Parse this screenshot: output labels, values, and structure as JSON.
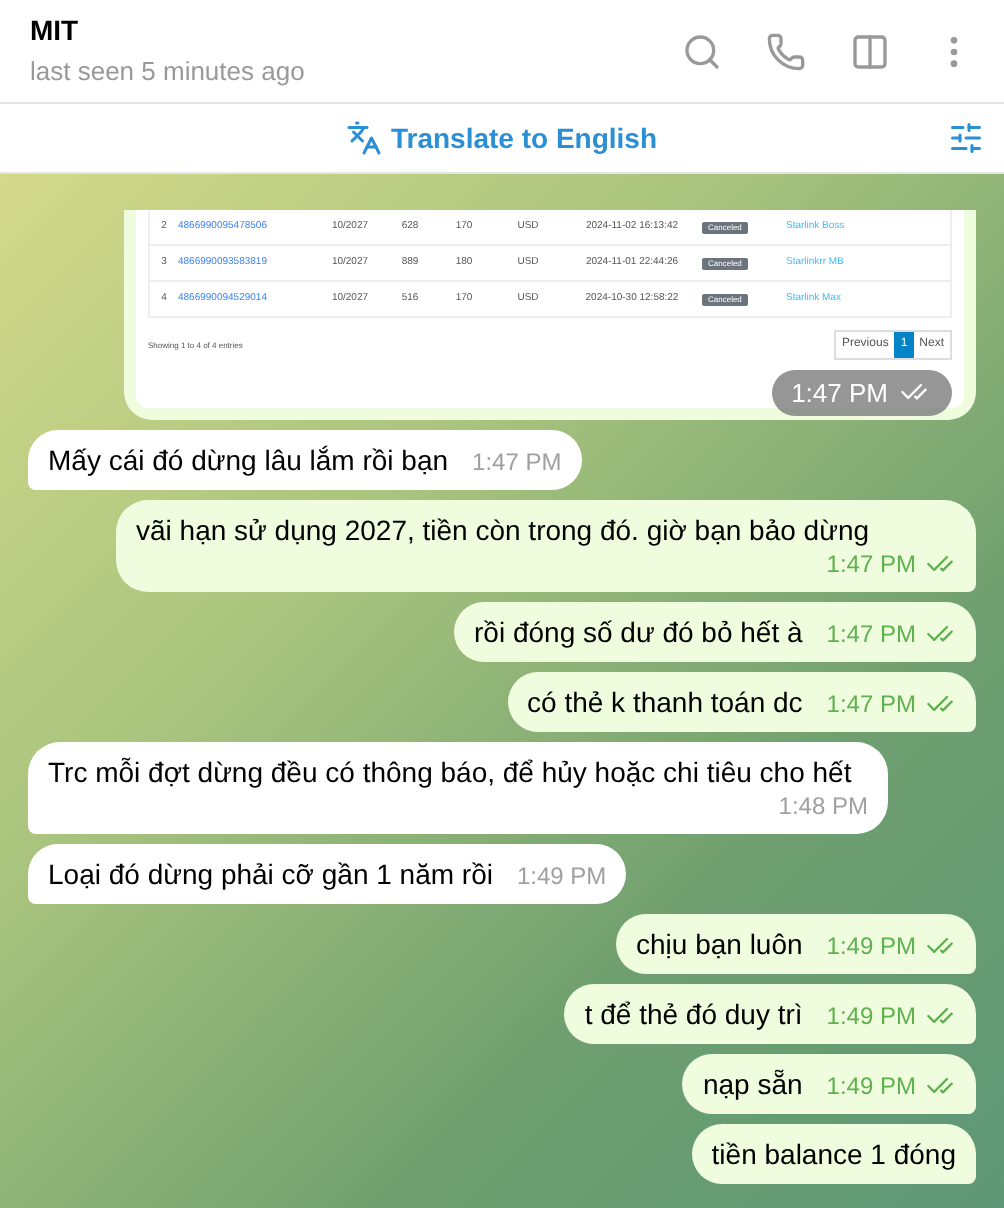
{
  "header": {
    "title": "MIT",
    "status": "last seen 5 minutes ago"
  },
  "translate_bar": {
    "label": "Translate to English"
  },
  "messages": [
    {
      "kind": "image",
      "time": "1:47 PM",
      "read": true,
      "table": {
        "rows": [
          [
            "2",
            "4866990095478506",
            "10/2027",
            "628",
            "170",
            "USD",
            "2024-11-02 16:13:42",
            "Canceled",
            "Starlink Boss"
          ],
          [
            "3",
            "4866990093583819",
            "10/2027",
            "889",
            "180",
            "USD",
            "2024-11-01 22:44:26",
            "Canceled",
            "Starlinkrr MB"
          ],
          [
            "4",
            "4866990094529014",
            "10/2027",
            "516",
            "170",
            "USD",
            "2024-10-30 12:58:22",
            "Canceled",
            "Starlink Max"
          ]
        ],
        "footer": "Showing 1 to 4 of 4 entries",
        "pagination": [
          {
            "label": "Previous",
            "selected": false
          },
          {
            "label": "1",
            "selected": true
          },
          {
            "label": "Next",
            "selected": false
          }
        ]
      }
    },
    {
      "kind": "incoming",
      "text": "Mấy cái đó dừng lâu lắm rồi bạn",
      "time": "1:47 PM"
    },
    {
      "kind": "outgoing",
      "text": "vãi hạn sử dụng 2027, tiền còn trong đó. giờ bạn bảo dừng",
      "time": "1:47 PM",
      "read": true
    },
    {
      "kind": "outgoing",
      "text": "rồi đóng số dư đó bỏ hết à",
      "time": "1:47 PM",
      "read": true
    },
    {
      "kind": "outgoing",
      "text": "có thẻ k thanh toán dc",
      "time": "1:47 PM",
      "read": true
    },
    {
      "kind": "incoming",
      "text": "Trc mỗi đợt dừng đều có thông báo, để hủy hoặc chi tiêu cho hết",
      "time": "1:48 PM"
    },
    {
      "kind": "incoming",
      "text": "Loại đó dừng phải cỡ gần 1 năm rồi",
      "time": "1:49 PM"
    },
    {
      "kind": "outgoing",
      "text": "chịu bạn luôn",
      "time": "1:49 PM",
      "read": true
    },
    {
      "kind": "outgoing",
      "text": "t để thẻ đó duy trì",
      "time": "1:49 PM",
      "read": true
    },
    {
      "kind": "outgoing",
      "text": "nạp sẵn",
      "time": "1:49 PM",
      "read": true
    },
    {
      "kind": "outgoing",
      "text": "tiền balance 1 đóng"
    }
  ]
}
